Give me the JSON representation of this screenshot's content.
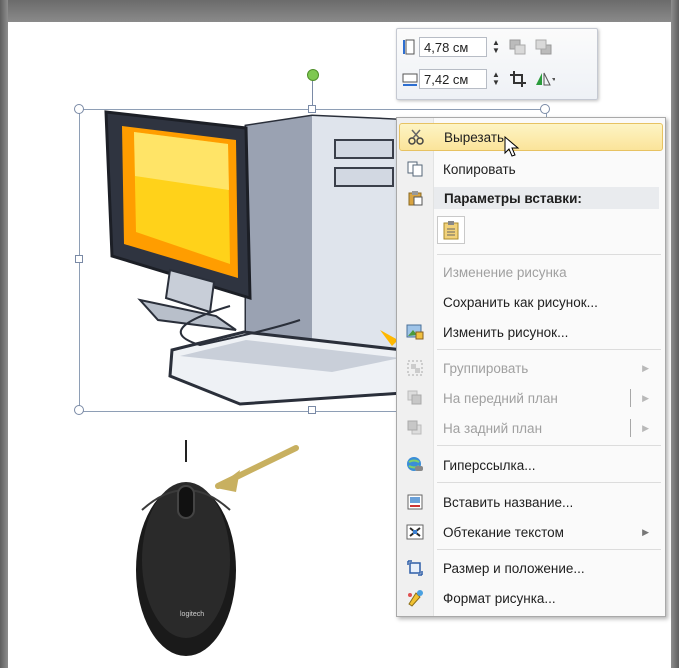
{
  "mini_toolbar": {
    "height_value": "4,78 см",
    "width_value": "7,42 см"
  },
  "context_menu": {
    "cut": "Вырезать",
    "copy": "Копировать",
    "paste_options_header": "Параметры вставки:",
    "change_picture_disabled": "Изменение рисунка",
    "save_as_picture": "Сохранить как рисунок...",
    "edit_picture": "Изменить рисунок...",
    "group": "Группировать",
    "bring_to_front": "На передний план",
    "send_to_back": "На задний план",
    "hyperlink": "Гиперссылка...",
    "insert_caption": "Вставить название...",
    "wrap_text": "Обтекание текстом",
    "size_position": "Размер и положение...",
    "format_picture": "Формат рисунка..."
  },
  "mouse_logo": "logitech",
  "colors": {
    "highlight": "#fbe49a",
    "monitor_screen": "#ffc400",
    "arrow": "#c8b060"
  },
  "icons": [
    "scissors-icon",
    "copy-icon",
    "paste-icon",
    "clipboard-icon",
    "edit-picture-icon",
    "group-icon",
    "bring-front-icon",
    "send-back-icon",
    "hyperlink-icon",
    "caption-icon",
    "wrap-text-icon",
    "size-icon",
    "format-icon"
  ]
}
